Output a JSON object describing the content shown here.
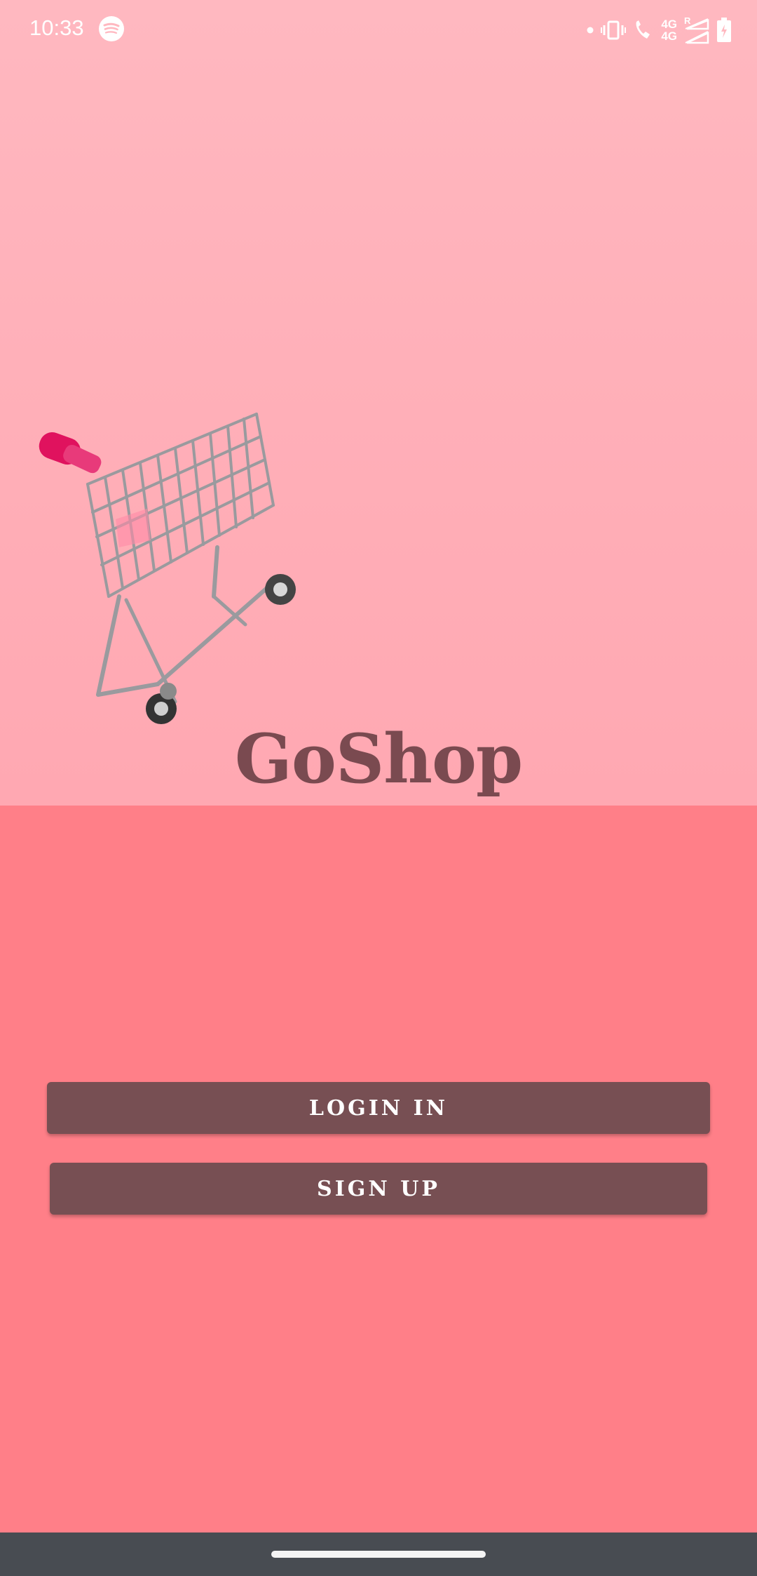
{
  "status_bar": {
    "time": "10:33",
    "network_top": "4G",
    "network_bottom": "4G",
    "roaming": "R",
    "icons": [
      "spotify-icon",
      "dot-icon",
      "vibrate-icon",
      "wifi-call-icon",
      "signal-icon",
      "battery-icon"
    ]
  },
  "hero": {
    "image": "shopping-cart-on-pink-background",
    "brand": "GoShop"
  },
  "actions": {
    "login_label": "LOGIN IN",
    "signup_label": "SIGN UP"
  },
  "colors": {
    "hero_bg": "#ffb0b9",
    "page_bg": "#ff7f88",
    "button_bg": "#774f53",
    "brand_text": "#7a4a50",
    "nav_bar": "#484c52"
  }
}
